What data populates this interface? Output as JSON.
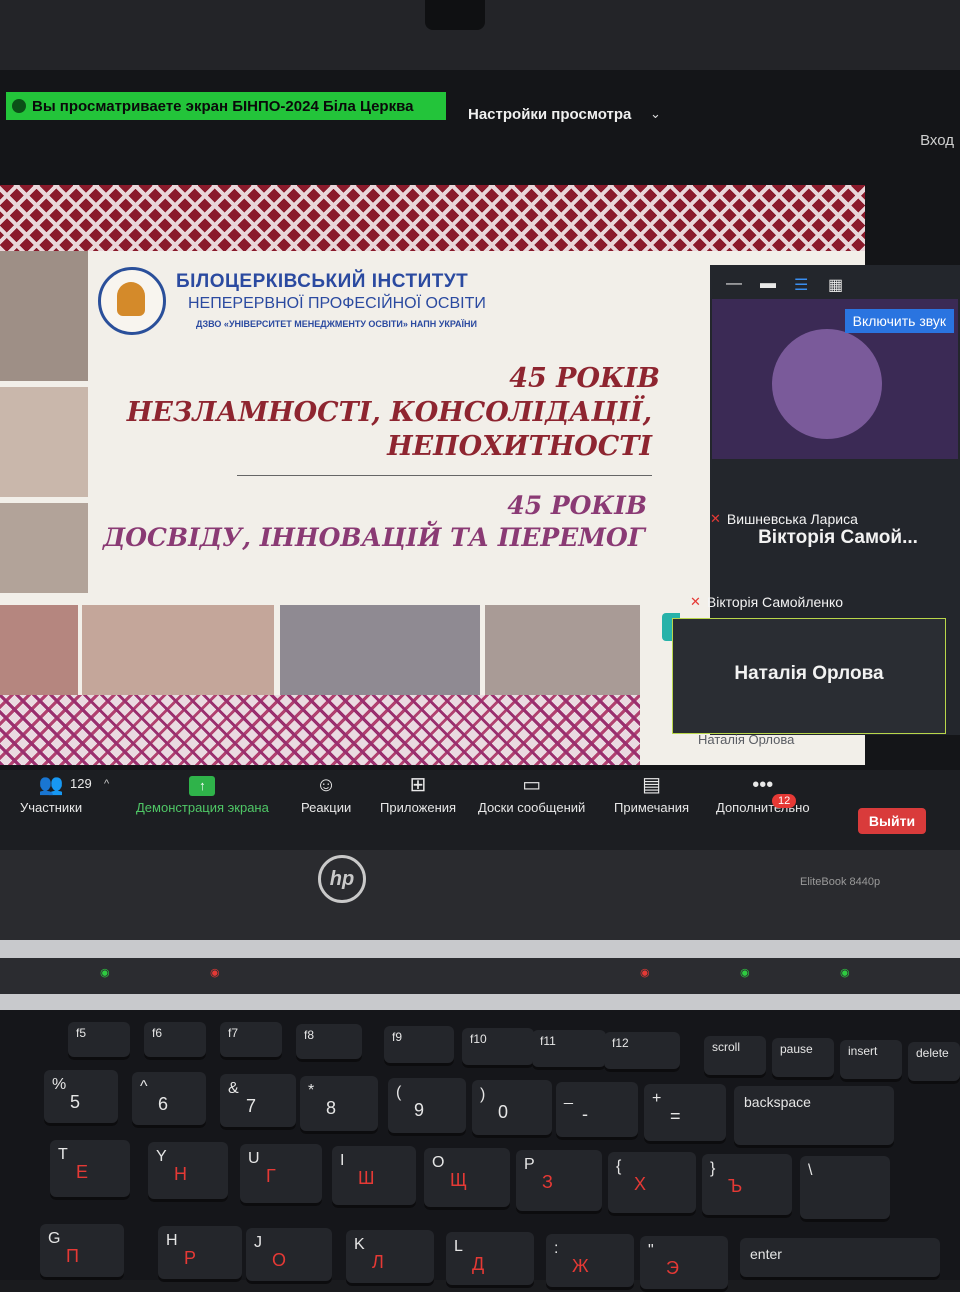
{
  "banner": {
    "text": "Вы просматриваете экран БІНПО-2024 Біла Церква"
  },
  "header": {
    "view_settings": "Настройки просмотра",
    "login": "Вход"
  },
  "slide": {
    "inst_title_1": "БІЛОЦЕРКІВСЬКИЙ ІНСТИТУТ",
    "inst_title_2": "НЕПЕРЕРВНОЇ ПРОФЕСІЙНОЇ ОСВІТИ",
    "inst_subtitle": "ДЗВО «УНІВЕРСИТЕТ МЕНЕДЖМЕНТУ ОСВІТИ» НАПН УКРАЇНИ",
    "heading_1": "45 РОКІВ",
    "heading_2": "НЕЗЛАМНОСТІ, КОНСОЛІДАЦІЇ,",
    "heading_3": "НЕПОХИТНОСТІ",
    "heading_4": "45 РОКІВ",
    "heading_5": "ДОСВІДУ, ІННОВАЦІЙ ТА ПЕРЕМОГ"
  },
  "participants_panel": {
    "unmute_label": "Включить звук",
    "tiles": [
      {
        "name": "Вишневська Лариса"
      },
      {
        "display": "Вікторія Самой...",
        "name": "Вікторія Самойленко"
      },
      {
        "display": "Наталія Орлова",
        "name": "Наталія Орлова"
      }
    ]
  },
  "toolbar": {
    "participants_count": "129",
    "participants": "Участники",
    "share_screen": "Демонстрация экрана",
    "reactions": "Реакции",
    "apps": "Приложения",
    "whiteboards": "Доски сообщений",
    "notes": "Примечания",
    "more": "Дополнительно",
    "more_badge": "12",
    "exit": "Выйти"
  },
  "laptop": {
    "brand": "hp",
    "model": "EliteBook 8440p"
  },
  "keyboard": {
    "fkeys": [
      "f5",
      "f6",
      "f7",
      "f8",
      "f9",
      "f10",
      "f11",
      "f12",
      "scroll",
      "pause",
      "insert",
      "delete"
    ],
    "row_num": [
      {
        "lat": "%",
        "sub": "5"
      },
      {
        "lat": "^",
        "sub": "6"
      },
      {
        "lat": "&",
        "sub": "7"
      },
      {
        "lat": "*",
        "sub": "8"
      },
      {
        "lat": "(",
        "sub": "9"
      },
      {
        "lat": ")",
        "sub": "0"
      },
      {
        "lat": "_",
        "sub": "-"
      },
      {
        "lat": "+",
        "sub": "="
      }
    ],
    "backspace": "backspace",
    "row_top": [
      {
        "lat": "T",
        "cyr": "Е"
      },
      {
        "lat": "Y",
        "cyr": "Н"
      },
      {
        "lat": "U",
        "cyr": "Г"
      },
      {
        "lat": "I",
        "cyr": "Ш"
      },
      {
        "lat": "O",
        "cyr": "Щ"
      },
      {
        "lat": "P",
        "cyr": "З"
      },
      {
        "lat": "{",
        "cyr": "Х"
      },
      {
        "lat": "}",
        "cyr": "Ъ"
      }
    ],
    "row_home": [
      {
        "lat": "G",
        "cyr": "П"
      },
      {
        "lat": "H",
        "cyr": "Р"
      },
      {
        "lat": "J",
        "cyr": "О"
      },
      {
        "lat": "K",
        "cyr": "Л"
      },
      {
        "lat": "L",
        "cyr": "Д"
      },
      {
        "lat": ":",
        "cyr": "Ж"
      },
      {
        "lat": "\"",
        "cyr": "Э"
      }
    ],
    "enter": "enter"
  }
}
